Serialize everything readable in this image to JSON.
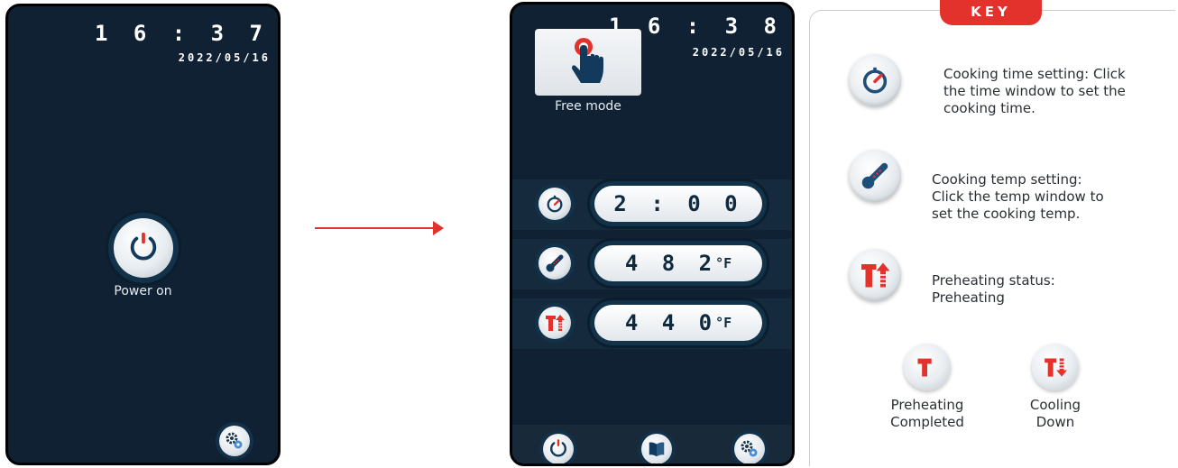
{
  "screen_left": {
    "clock": "1 6 : 3 7",
    "date": "2022/05/16",
    "power_label": "Power on"
  },
  "screen_right": {
    "clock": "1 6 : 3 8",
    "date": "2022/05/16",
    "free_mode_label": "Free mode",
    "time_value": "2 : 0 0",
    "temp_value": "4 8 2",
    "preheat_value": "4 4 0",
    "temp_unit": "°F"
  },
  "key": {
    "title": "KEY",
    "time_desc": [
      "Cooking time setting: Click",
      "the time window to set the",
      "cooking time."
    ],
    "temp_desc": [
      "Cooking temp setting:",
      "Click the temp window to",
      "set the cooking temp."
    ],
    "preheat_desc": [
      "Preheating status:",
      "Preheating"
    ],
    "completed_caption": [
      "Preheating",
      "Completed"
    ],
    "cooling_caption": [
      "Cooling",
      "Down"
    ]
  },
  "icons": {
    "power": "power-icon",
    "settings": "settings-gears-icon",
    "book": "recipe-book-icon",
    "timer": "timer-icon",
    "thermometer": "thermometer-icon",
    "preheating": "preheating-icon",
    "hand": "touch-hand-icon"
  },
  "colors": {
    "screen_bg": "#0f2133",
    "accent_red": "#e3312b",
    "key_blue": "#1d4f7a"
  }
}
